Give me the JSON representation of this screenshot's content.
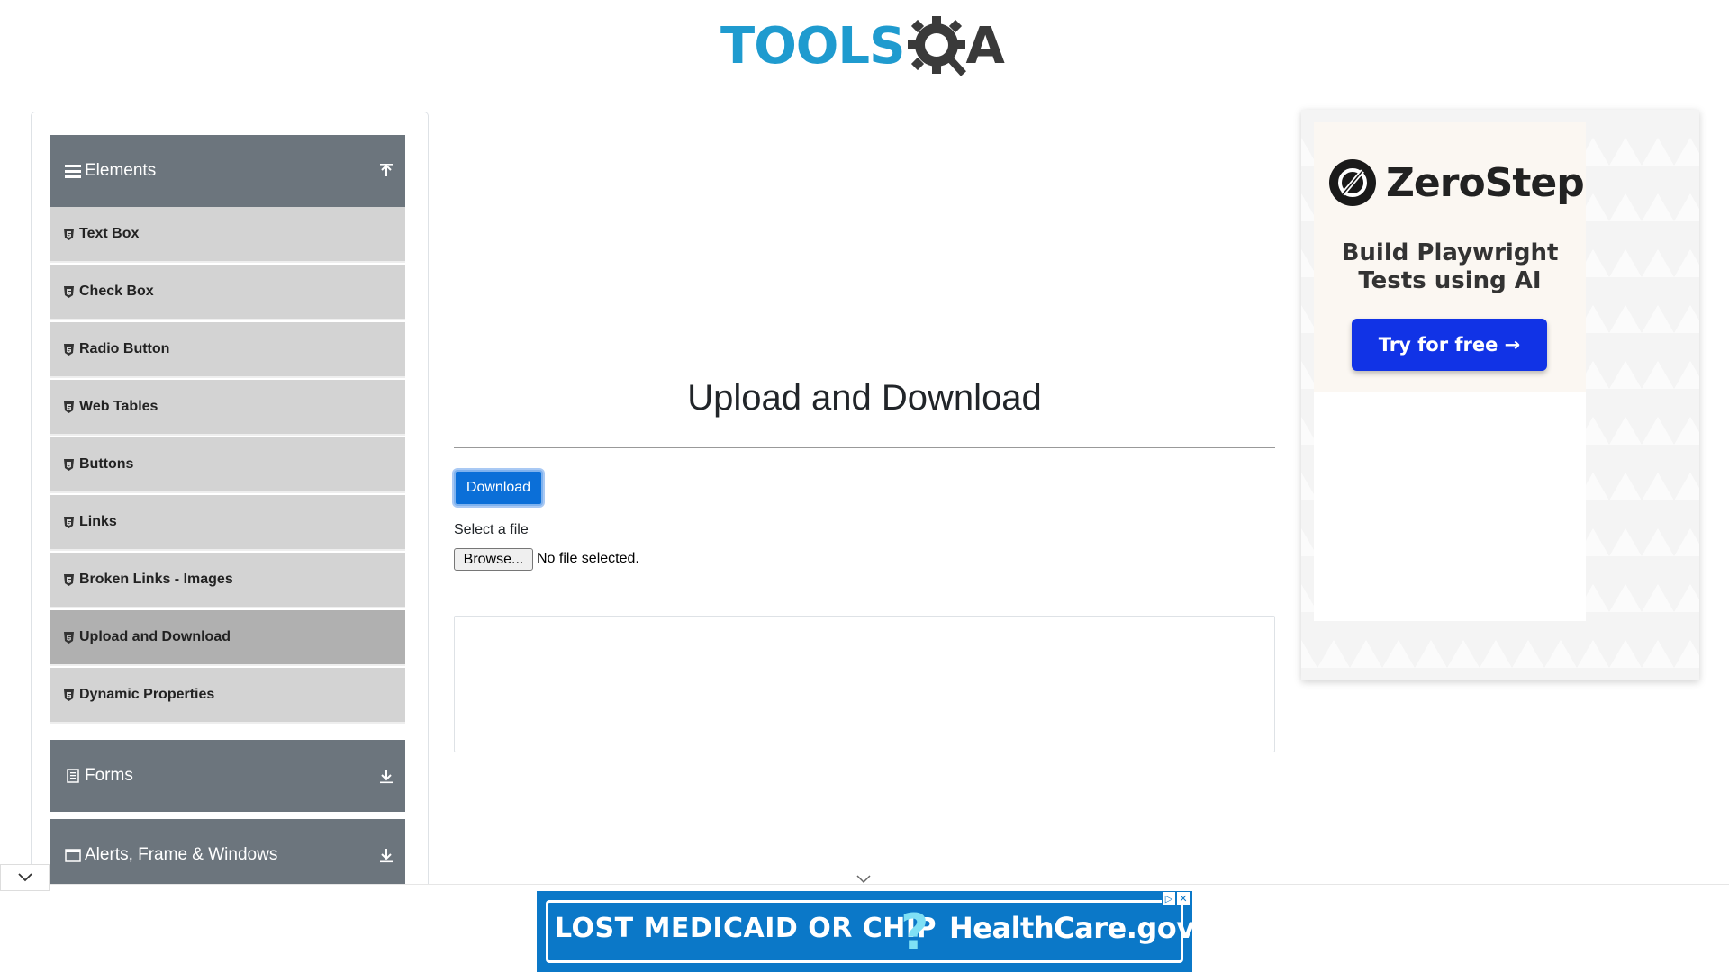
{
  "header": {
    "logo_text": "TOOLS",
    "logo_suffix": "A"
  },
  "sidebar": {
    "groups": [
      {
        "label": "Elements",
        "expanded": true
      },
      {
        "label": "Forms",
        "expanded": false
      },
      {
        "label": "Alerts, Frame & Windows",
        "expanded": false
      }
    ],
    "items": [
      {
        "label": "Text Box"
      },
      {
        "label": "Check Box"
      },
      {
        "label": "Radio Button"
      },
      {
        "label": "Web Tables"
      },
      {
        "label": "Buttons"
      },
      {
        "label": "Links"
      },
      {
        "label": "Broken Links - Images"
      },
      {
        "label": "Upload and Download",
        "active": true
      },
      {
        "label": "Dynamic Properties"
      }
    ]
  },
  "main": {
    "title": "Upload and Download",
    "download_label": "Download",
    "select_file_label": "Select a file",
    "browse_label": "Browse...",
    "no_file_text": "No file selected."
  },
  "side_ad": {
    "brand": "ZeroStep",
    "tagline_line1": "Build Playwright",
    "tagline_line2": "Tests using AI",
    "cta": "Try for free →"
  },
  "bottom_ad": {
    "text1": "LOST MEDICAID OR CHIP",
    "text2": "HealthCare.gov"
  },
  "colors": {
    "primary": "#0b6fd8",
    "sidebar_header": "#6c757d",
    "menu_item": "#d3d3d3",
    "menu_item_active": "#b0b0b0",
    "logo_blue": "#1f9bcf",
    "ad_cta": "#1133e6"
  }
}
